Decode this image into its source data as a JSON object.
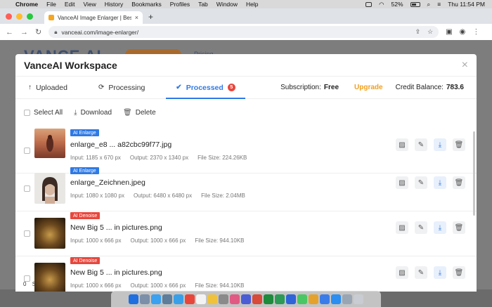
{
  "menubar": {
    "apple": "",
    "items": [
      "Chrome",
      "File",
      "Edit",
      "View",
      "History",
      "Bookmarks",
      "Profiles",
      "Tab",
      "Window",
      "Help"
    ],
    "battery": "52%",
    "clock": "Thu 11:54 PM"
  },
  "browser": {
    "tab_title": "VanceAI Image Enlarger | Best",
    "tab_close": "×",
    "new_tab": "+",
    "url": "vanceai.com/image-enlarger/"
  },
  "page_bg": {
    "logo": "VANCE AI",
    "nav1": "Pricing"
  },
  "modal": {
    "title": "VanceAI Workspace",
    "close": "×",
    "tabs": [
      {
        "label": "Uploaded",
        "icon": "↑"
      },
      {
        "label": "Processing",
        "icon": "⟳"
      },
      {
        "label": "Processed",
        "icon": "✔",
        "badge": "5"
      }
    ],
    "subscription_label": "Subscription:",
    "subscription_value": "Free",
    "upgrade": "Upgrade",
    "credit_label": "Credit Balance:",
    "credit_value": "783.6",
    "toolbar": {
      "select_all": "Select All",
      "download": "Download",
      "delete": "Delete"
    },
    "rows": [
      {
        "tag": "AI Enlarge",
        "name": "enlarge_e8 ... a82cbc99f77.jpg",
        "input": "Input: 1185 x 670 px",
        "output": "Output: 2370 x 1340 px",
        "size": "File Size: 224.26KB"
      },
      {
        "tag": "AI Enlarge",
        "name": "enlarge_Zeichnen.jpeg",
        "input": "Input: 1080 x 1080 px",
        "output": "Output: 6480 x 6480 px",
        "size": "File Size: 2.04MB"
      },
      {
        "tag": "AI Denoise",
        "name": "New Big 5 ... in pictures.png",
        "input": "Input: 1000 x 666 px",
        "output": "Output: 1000 x 666 px",
        "size": "File Size: 944.10KB"
      },
      {
        "tag": "AI Denoise",
        "name": "New Big 5 ... in pictures.png",
        "input": "Input: 1000 x 666 px",
        "output": "Output: 1000 x 666 px",
        "size": "File Size: 944.10KB"
      }
    ],
    "footer_count": "0",
    "footer_label": "S"
  },
  "colors": {
    "accent": "#2f7ae5",
    "badge": "#e8473d",
    "upgrade": "#f0a020",
    "tag_enlarge": "#2f7ae5",
    "tag_denoise": "#e8473d"
  },
  "icons": {
    "row_actions": [
      "compare-icon",
      "edit-icon",
      "download-icon",
      "trash-icon"
    ]
  }
}
